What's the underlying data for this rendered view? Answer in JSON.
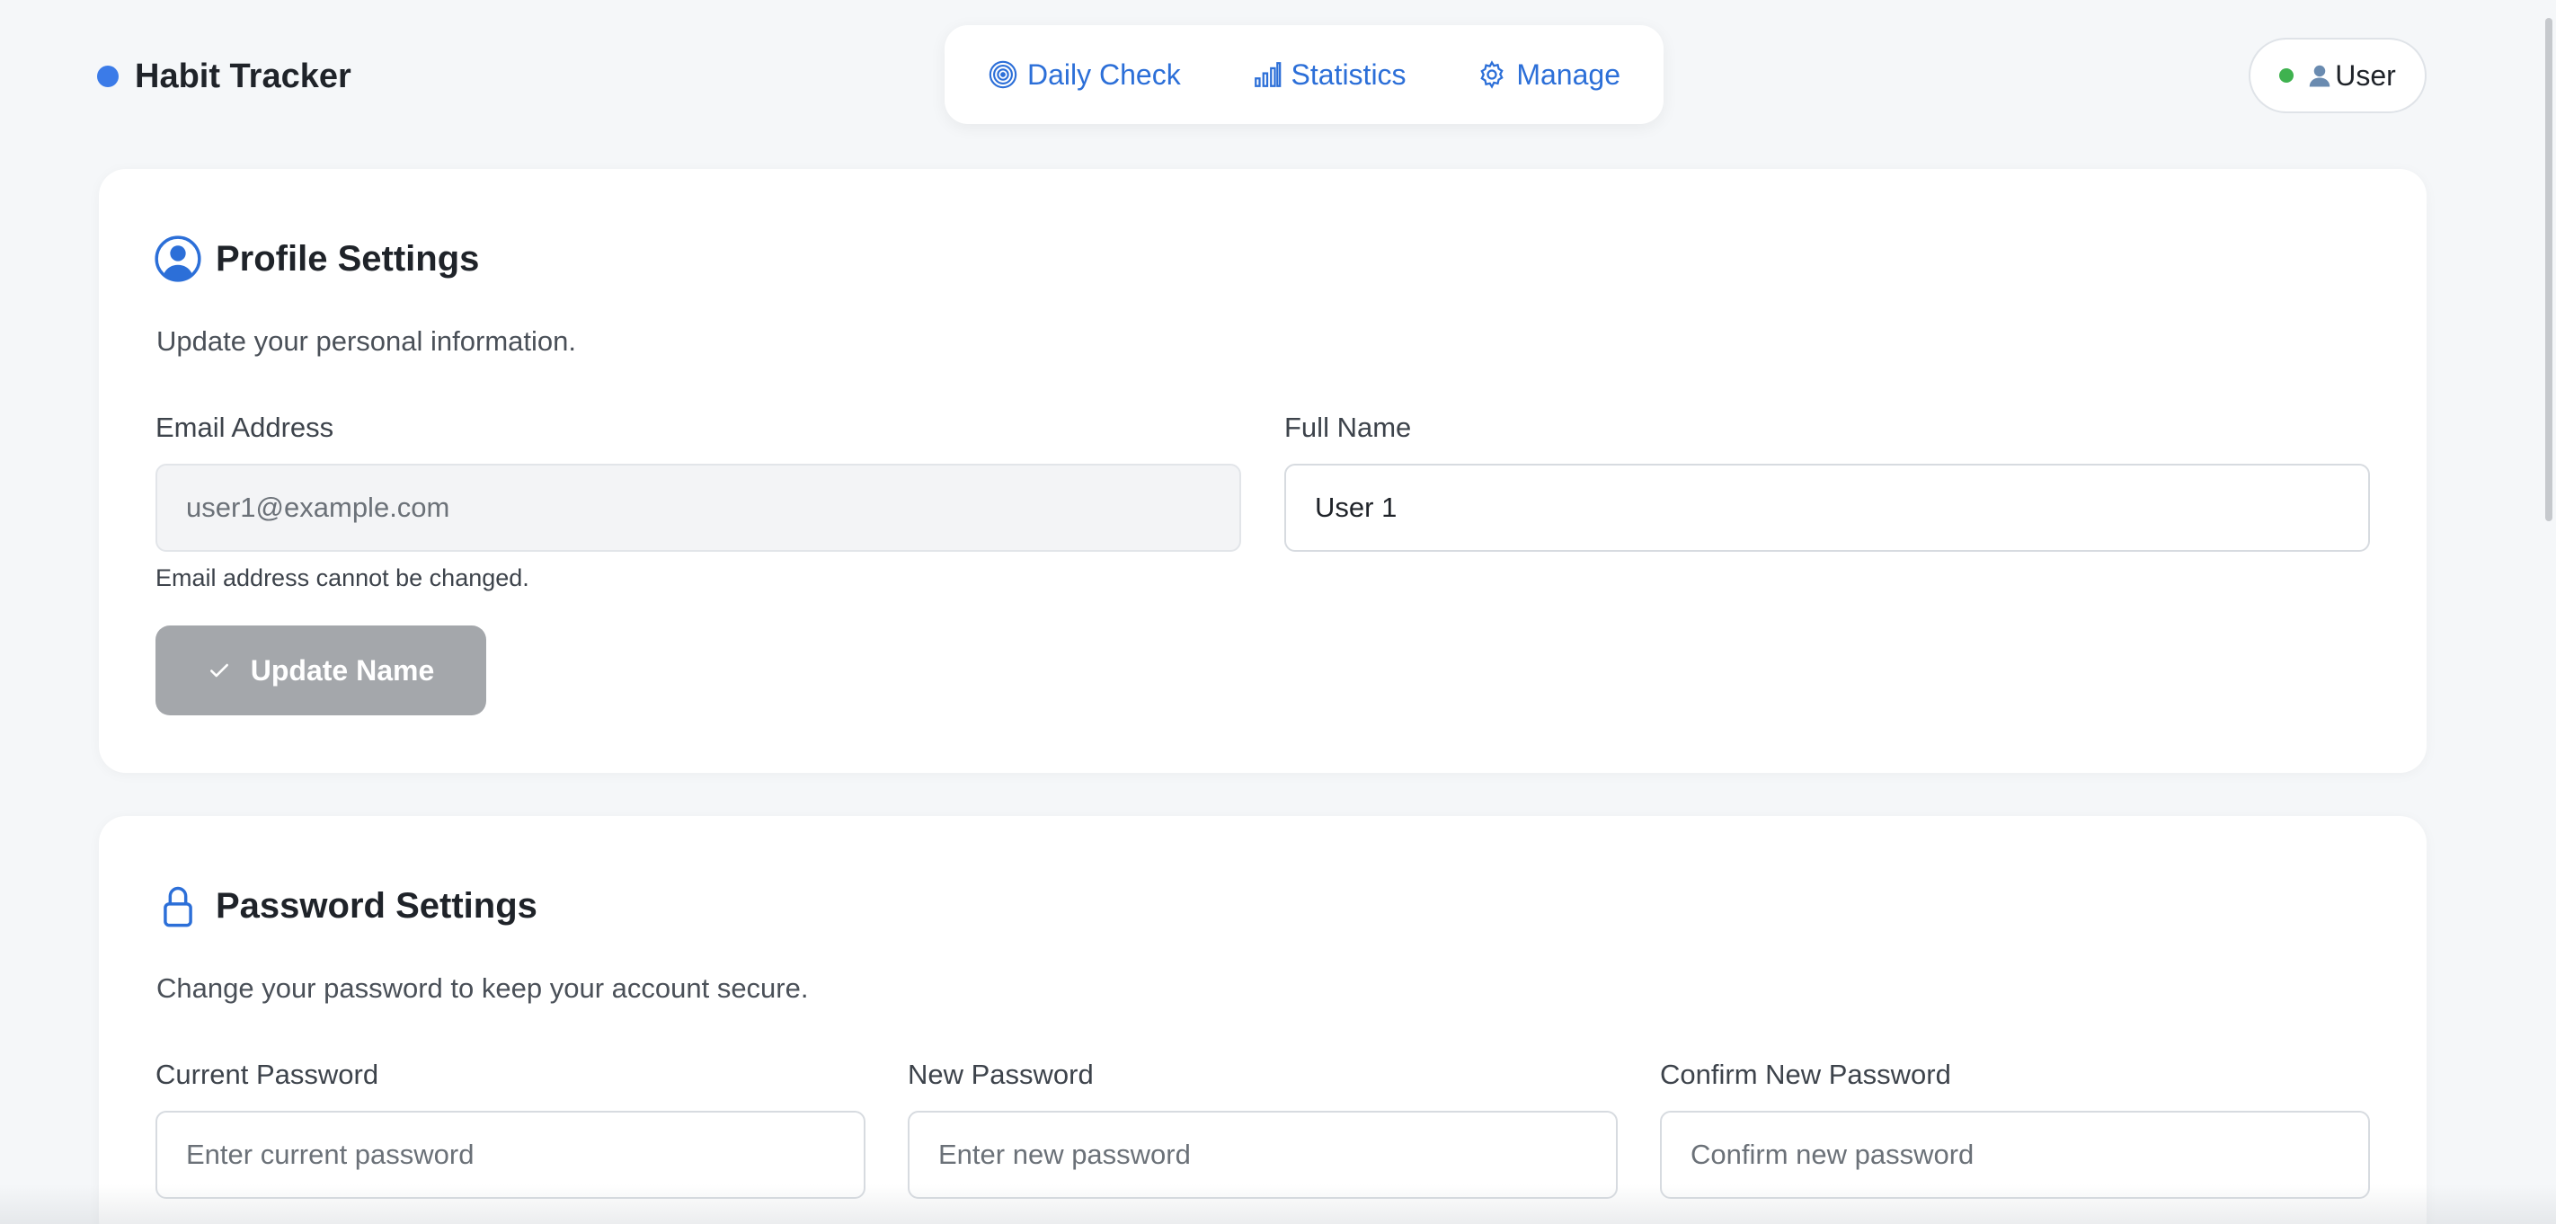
{
  "header": {
    "brand_title": "Habit Tracker",
    "brand_color": "#3b7be8",
    "nav": [
      {
        "label": "Daily Check",
        "icon": "target-icon"
      },
      {
        "label": "Statistics",
        "icon": "bar-chart-icon"
      },
      {
        "label": "Manage",
        "icon": "gear-icon"
      }
    ],
    "user_label": "User",
    "status_color": "#3fb24f"
  },
  "profile": {
    "title": "Profile Settings",
    "description": "Update your personal information.",
    "email_label": "Email Address",
    "email_value": "user1@example.com",
    "email_hint": "Email address cannot be changed.",
    "name_label": "Full Name",
    "name_value": "User 1",
    "update_button": "Update Name"
  },
  "password": {
    "title": "Password Settings",
    "description": "Change your password to keep your account secure.",
    "current_label": "Current Password",
    "current_placeholder": "Enter current password",
    "new_label": "New Password",
    "new_placeholder": "Enter new password",
    "confirm_label": "Confirm New Password",
    "confirm_placeholder": "Confirm new password"
  }
}
